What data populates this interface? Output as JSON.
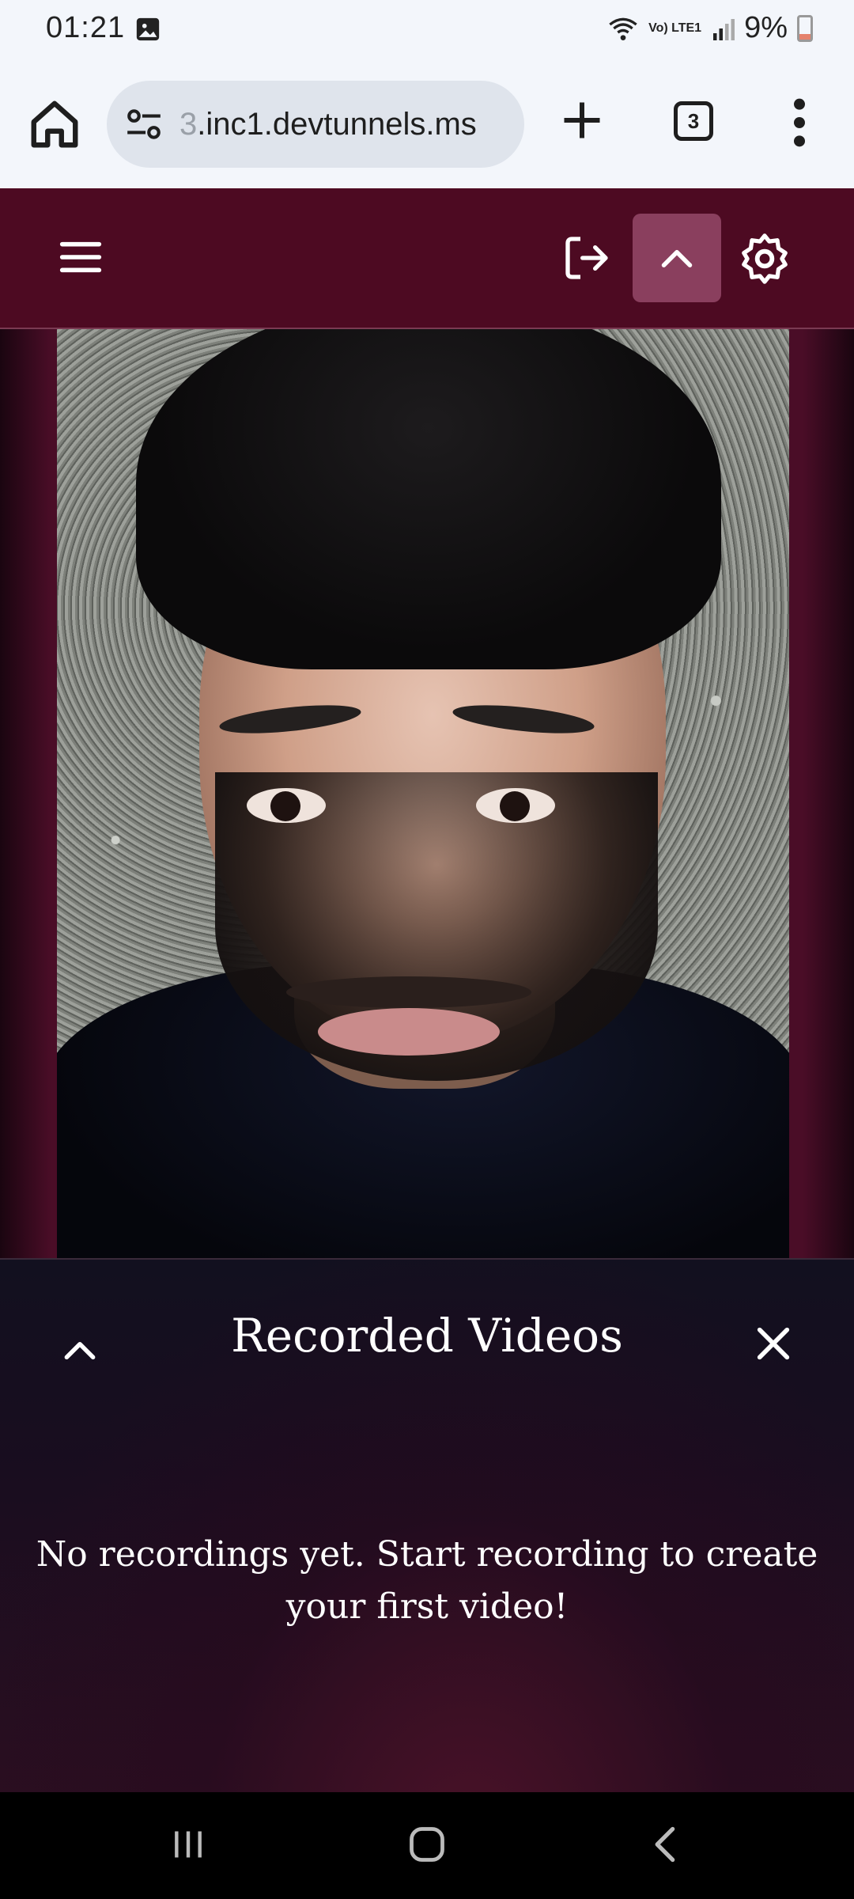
{
  "status_bar": {
    "time": "01:21",
    "network_label": "Vo) LTE1",
    "battery_percent": "9%",
    "battery_level": 0.09,
    "icons": [
      "image-icon",
      "wifi-icon",
      "signal-icon",
      "battery-icon"
    ]
  },
  "browser": {
    "url_prefix": "3",
    "url_main": ".inc1.devtunnels.ms",
    "tab_count": "3",
    "icons": [
      "home-icon",
      "site-settings-icon",
      "new-tab-icon",
      "tab-switcher-icon",
      "overflow-menu-icon"
    ]
  },
  "app_header": {
    "icons": [
      "hamburger-menu-icon",
      "logout-icon",
      "chevron-up-icon",
      "gear-icon"
    ],
    "colors": {
      "header_bg": "#4d0a22",
      "active_button_bg": "#8a3f5e"
    }
  },
  "videos_panel": {
    "title": "Recorded Videos",
    "empty_message": "No recordings yet. Start recording to create your first video!",
    "icons": [
      "chevron-up-icon",
      "close-icon"
    ]
  },
  "nav_bar": {
    "icons": [
      "recents-icon",
      "home-icon",
      "back-icon"
    ]
  }
}
